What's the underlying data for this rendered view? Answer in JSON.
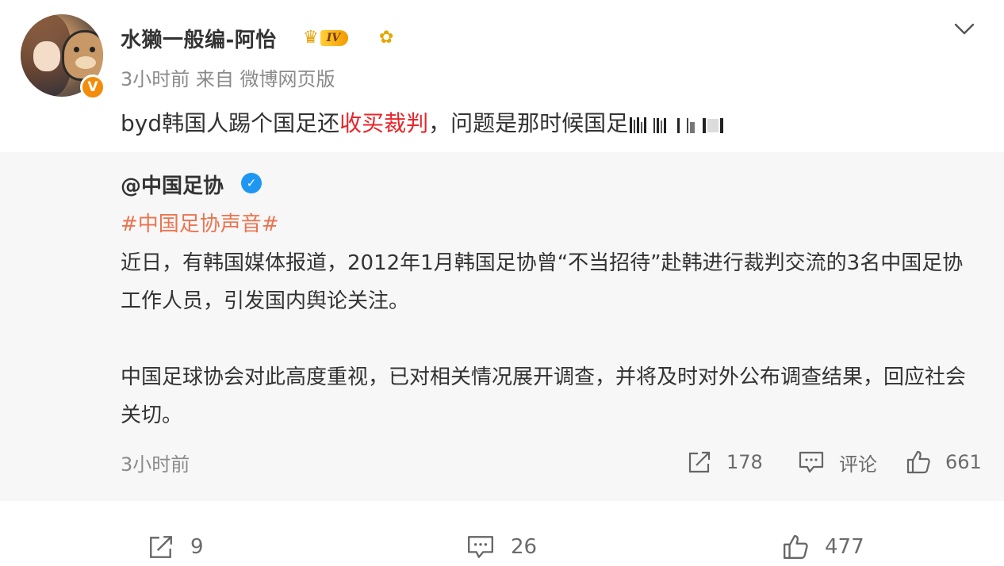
{
  "post": {
    "username": "水獭一般编-阿怡",
    "vip_level": "IV",
    "meta": "3小时前  来自 微博网页版",
    "text_before": "byd韩国人踢个国足还",
    "text_highlight": "收买裁判",
    "text_after": "，问题是那时候国足",
    "icons": {
      "avatar": "avatar",
      "verified": "orange-v-verified-icon",
      "crown": "crown-icon",
      "flower": "sunflower-icon",
      "expand": "chevron-down-icon"
    },
    "colors": {
      "highlight": "#e8252a",
      "topic": "#eb7350",
      "verified_orange": "#f38c0a",
      "verified_blue": "#1e97f2"
    }
  },
  "repost": {
    "author": "@中国足协",
    "topic": "#中国足协声音#",
    "paragraph1": "近日，有韩国媒体报道，2012年1月韩国足协曾“不当招待”赴韩进行裁判交流的3名中国足协工作人员，引发国内舆论关注。",
    "paragraph2": "中国足球协会对此高度重视，已对相关情况展开调查，并将及时对外公布调查结果，回应社会关切。",
    "time": "3小时前",
    "share_count": "178",
    "comment_label": "评论",
    "like_count": "661"
  },
  "toolbar": {
    "share_count": "9",
    "comment_count": "26",
    "like_count": "477"
  }
}
